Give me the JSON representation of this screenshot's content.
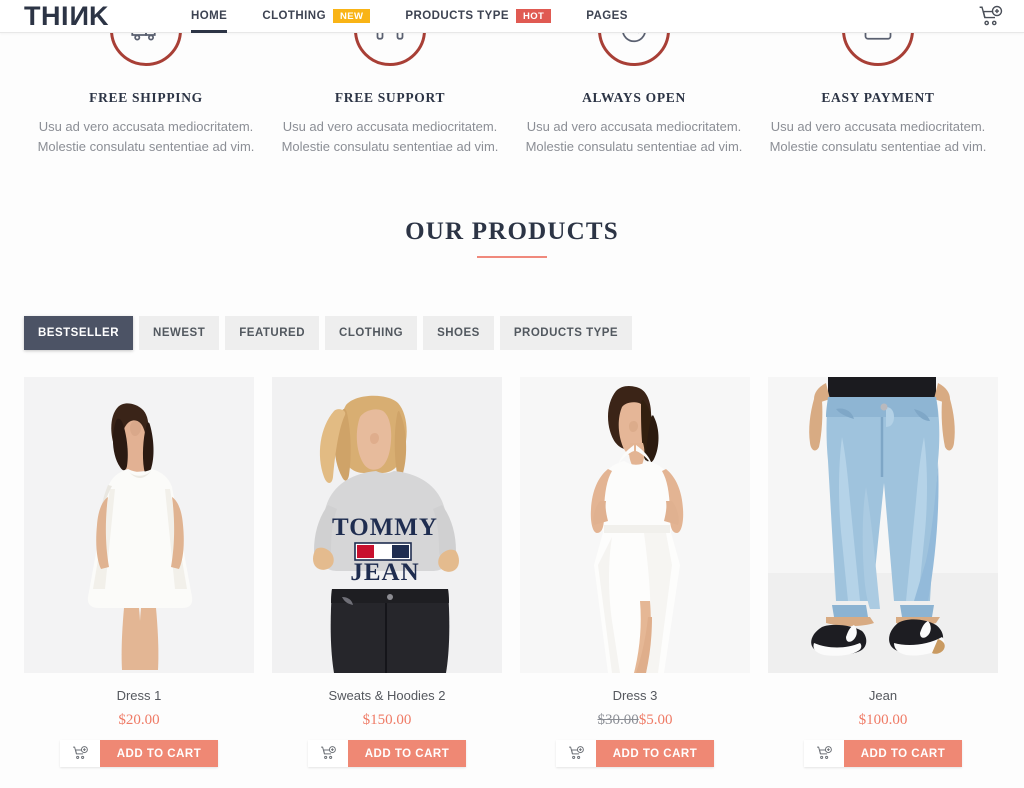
{
  "header": {
    "logo_text_a": "THI",
    "logo_text_b": "N",
    "logo_text_c": "K",
    "nav": [
      {
        "label": "HOME",
        "active": true,
        "badge": null
      },
      {
        "label": "CLOTHING",
        "active": false,
        "badge": "NEW"
      },
      {
        "label": "PRODUCTS TYPE",
        "active": false,
        "badge": "HOT"
      },
      {
        "label": "PAGES",
        "active": false,
        "badge": null
      }
    ],
    "cart_icon": "cart-plus-icon",
    "accent_new": "#f9b416",
    "accent_hot": "#e05a52",
    "logo_color": "#2c3445"
  },
  "features": [
    {
      "icon": "shipping-truck-icon",
      "title": "FREE SHIPPING",
      "line1": "Usu ad vero accusata mediocritatem.",
      "line2": "Molestie consulatu sententiae ad vim."
    },
    {
      "icon": "headset-support-icon",
      "title": "FREE SUPPORT",
      "line1": "Usu ad vero accusata mediocritatem.",
      "line2": "Molestie consulatu sententiae ad vim."
    },
    {
      "icon": "clock-icon",
      "title": "ALWAYS OPEN",
      "line1": "Usu ad vero accusata mediocritatem.",
      "line2": "Molestie consulatu sententiae ad vim."
    },
    {
      "icon": "credit-card-icon",
      "title": "EASY PAYMENT",
      "line1": "Usu ad vero accusata mediocritatem.",
      "line2": "Molestie consulatu sententiae ad vim."
    }
  ],
  "products_section": {
    "title": "OUR PRODUCTS",
    "rule_color": "#f0897c",
    "filters": [
      {
        "label": "BESTSELLER",
        "active": true
      },
      {
        "label": "NEWEST",
        "active": false
      },
      {
        "label": "FEATURED",
        "active": false
      },
      {
        "label": "CLOTHING",
        "active": false
      },
      {
        "label": "SHOES",
        "active": false
      },
      {
        "label": "PRODUCTS TYPE",
        "active": false
      }
    ],
    "add_to_cart_label": "ADD TO CART",
    "cart_icon": "cart-plus-icon",
    "price_color": "#ef7b66",
    "button_color": "#ef8874",
    "products": [
      {
        "name": "Dress 1",
        "price": "$20.00",
        "old_price": null,
        "image": "woman-in-white-sleeveless-shift-dress"
      },
      {
        "name": "Sweats & Hoodies 2",
        "price": "$150.00",
        "old_price": null,
        "image": "woman-in-grey-tommy-jean-sweatshirt-and-black-jeans"
      },
      {
        "name": "Dress 3",
        "price": "$5.00",
        "old_price": "$30.00",
        "image": "woman-in-white-halter-midi-dress"
      },
      {
        "name": "Jean",
        "price": "$100.00",
        "old_price": null,
        "image": "light-wash-cropped-jeans-with-black-sneakers"
      }
    ]
  }
}
